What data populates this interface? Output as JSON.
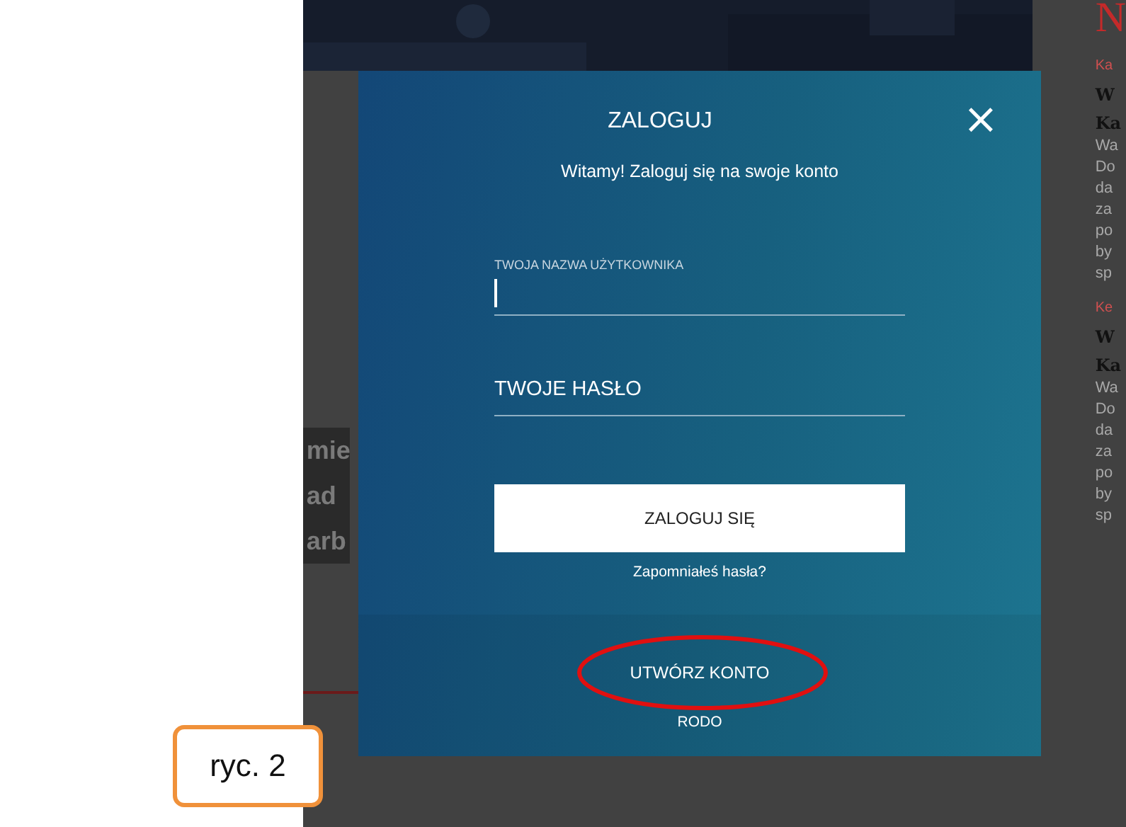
{
  "figure_label": "ryc. 2",
  "page": {
    "headline_fragments": [
      "mie",
      "ad",
      "arb"
    ],
    "sidebar": {
      "heading": "N",
      "articles": [
        {
          "category": "Ka",
          "title_lines": [
            "W",
            "Ka"
          ],
          "excerpt_lines": [
            "Wa",
            "Do",
            "da",
            "za",
            "po",
            "by",
            "sp"
          ]
        },
        {
          "category": "Ke",
          "title_lines": [
            "W",
            "Ka"
          ],
          "excerpt_lines": [
            "Wa",
            "Do",
            "da",
            "za",
            "po",
            "by",
            "sp"
          ]
        }
      ]
    }
  },
  "modal": {
    "title": "ZALOGUJ",
    "close": "×",
    "subtitle": "Witamy! Zaloguj się na swoje konto",
    "fields": [
      {
        "kind": "labeled",
        "label": "TWOJA NAZWA UŻYTKOWNIKA",
        "focused": true
      },
      {
        "kind": "placeholder",
        "placeholder": "TWOJE HASŁO",
        "focused": false
      }
    ],
    "submit": "ZALOGUJ SIĘ",
    "forgot": "Zapomniałeś hasła?",
    "create_account": "UTWÓRZ KONTO",
    "rodo": "RODO"
  }
}
